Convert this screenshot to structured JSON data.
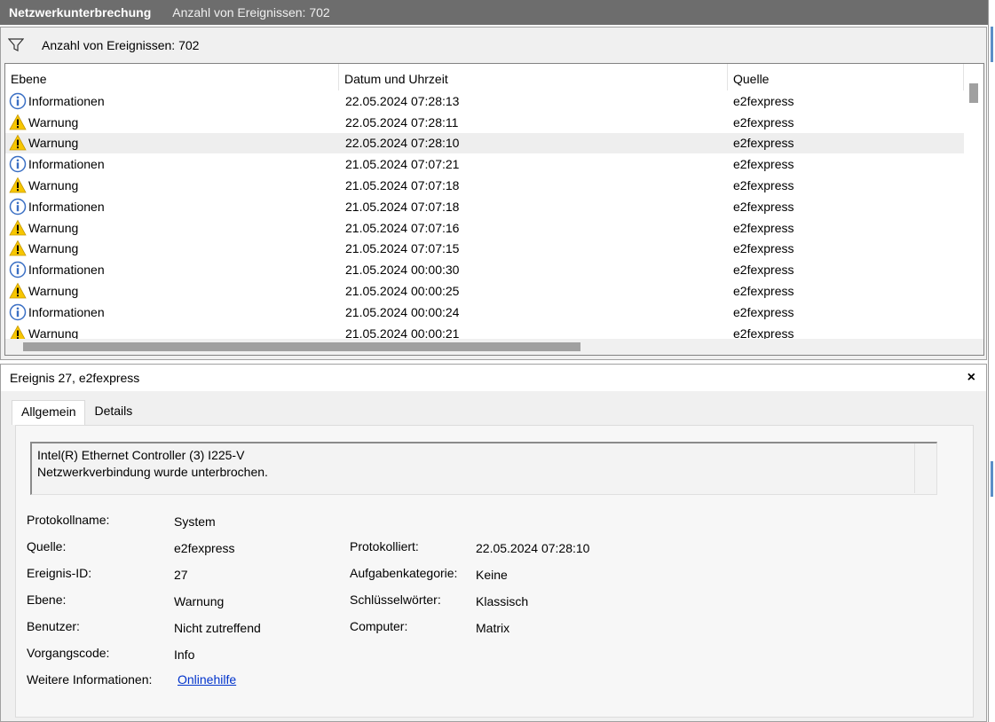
{
  "titlebar": {
    "name": "Netzwerkunterbrechung",
    "count": "Anzahl von Ereignissen: 702"
  },
  "filterbar": {
    "text": "Anzahl von Ereignissen: 702",
    "icon": "filter-icon"
  },
  "grid": {
    "headers": [
      "Ebene",
      "Datum und Uhrzeit",
      "Quelle"
    ],
    "rows": [
      {
        "level": "Informationen",
        "icon": "info",
        "date": "22.05.2024 07:28:13",
        "source": "e2fexpress"
      },
      {
        "level": "Warnung",
        "icon": "warning",
        "date": "22.05.2024 07:28:11",
        "source": "e2fexpress"
      },
      {
        "level": "Warnung",
        "icon": "warning",
        "date": "22.05.2024 07:28:10",
        "source": "e2fexpress"
      },
      {
        "level": "Informationen",
        "icon": "info",
        "date": "21.05.2024 07:07:21",
        "source": "e2fexpress"
      },
      {
        "level": "Warnung",
        "icon": "warning",
        "date": "21.05.2024 07:07:18",
        "source": "e2fexpress"
      },
      {
        "level": "Informationen",
        "icon": "info",
        "date": "21.05.2024 07:07:18",
        "source": "e2fexpress"
      },
      {
        "level": "Warnung",
        "icon": "warning",
        "date": "21.05.2024 07:07:16",
        "source": "e2fexpress"
      },
      {
        "level": "Warnung",
        "icon": "warning",
        "date": "21.05.2024 07:07:15",
        "source": "e2fexpress"
      },
      {
        "level": "Informationen",
        "icon": "info",
        "date": "21.05.2024 00:00:30",
        "source": "e2fexpress"
      },
      {
        "level": "Warnung",
        "icon": "warning",
        "date": "21.05.2024 00:00:25",
        "source": "e2fexpress"
      },
      {
        "level": "Informationen",
        "icon": "info",
        "date": "21.05.2024 00:00:24",
        "source": "e2fexpress"
      },
      {
        "level": "Warnung",
        "icon": "warning",
        "date": "21.05.2024 00:00:21",
        "source": "e2fexpress"
      }
    ],
    "selected_index": 2
  },
  "detail": {
    "header": "Ereignis 27, e2fexpress",
    "close": "×",
    "tabs": [
      "Allgemein",
      "Details"
    ],
    "message_line1": "Intel(R) Ethernet Controller (3) I225-V",
    "message_line2": "Netzwerkverbindung wurde unterbrochen.",
    "labels": {
      "protokollname": "Protokollname:",
      "quelle": "Quelle:",
      "ereignis_id": "Ereignis-ID:",
      "ebene": "Ebene:",
      "benutzer": "Benutzer:",
      "vorgangscode": "Vorgangscode:",
      "weitere": "Weitere Informationen:",
      "protokolliert": "Protokolliert:",
      "aufgabenkategorie": "Aufgabenkategorie:",
      "schluesselwoerter": "Schlüsselwörter:",
      "computer": "Computer:"
    },
    "values": {
      "protokollname": "System",
      "quelle": "e2fexpress",
      "ereignis_id": "27",
      "ebene": "Warnung",
      "benutzer": "Nicht zutreffend",
      "vorgangscode": "Info",
      "weitere": "Onlinehilfe",
      "protokolliert": "22.05.2024 07:28:10",
      "aufgabenkategorie": "Keine",
      "schluesselwoerter": "Klassisch",
      "computer": "Matrix"
    }
  },
  "colors": {
    "titlebar": "#6d6d6d",
    "link": "#0033cc",
    "info_blue": "#3a6fc4",
    "warning_yellow": "#f7c600"
  }
}
